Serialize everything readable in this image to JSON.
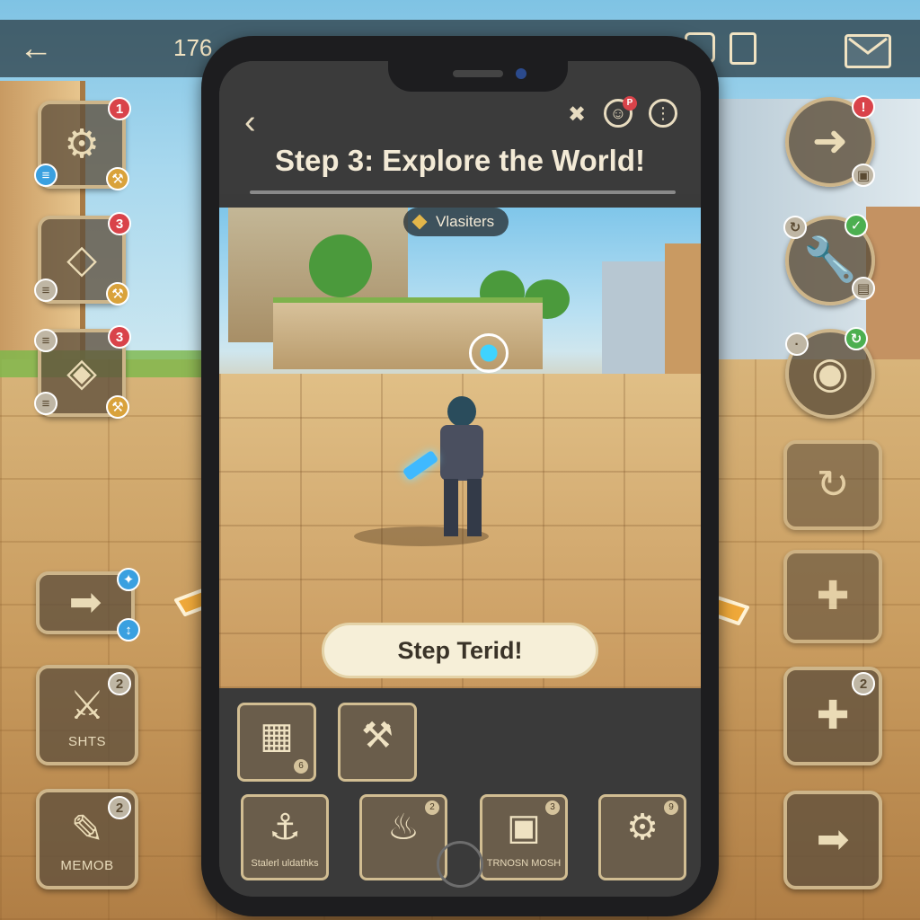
{
  "top_bar": {
    "back_label": "←",
    "counter_text": "176"
  },
  "phone": {
    "back_label": "‹",
    "title": "Step 3: Explore the World!",
    "badge_flag": "P",
    "location_tag": "Vlasiters",
    "step_button_label": "Step Terid!"
  },
  "left_buttons": [
    {
      "badge": "1"
    },
    {
      "badge": "3"
    },
    {
      "badge": "3"
    },
    {
      "badge": ""
    },
    {
      "badge": "2",
      "label": "SHTS"
    },
    {
      "badge": "2",
      "label": "MEMOB"
    }
  ],
  "right_buttons": [
    {
      "badge": ""
    },
    {
      "badge": ""
    },
    {
      "badge": ""
    },
    {
      "badge": "2"
    }
  ],
  "panel_buttons": [
    {
      "label": "",
      "badge": "6"
    },
    {
      "label": "",
      "badge": ""
    },
    {
      "label": "Stalerl uldathks",
      "badge": ""
    },
    {
      "label": "",
      "badge": "2"
    },
    {
      "label": "TRNOSN MOSH",
      "badge": "3"
    },
    {
      "label": "",
      "badge": "9"
    }
  ],
  "colors": {
    "accent_orange": "#f0a93a",
    "panel_bg": "#3a3a3a",
    "button_border": "#cdb58a",
    "badge_red": "#d9434a",
    "badge_blue": "#3aa0e0"
  }
}
